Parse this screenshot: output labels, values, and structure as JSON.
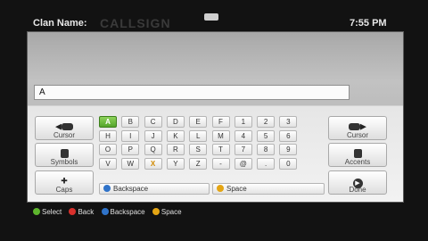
{
  "header": {
    "clan_label": "Clan Name:",
    "clan_ghost": "CALLSIGN",
    "time": "7:55 PM"
  },
  "input": {
    "value": "A"
  },
  "left_buttons": [
    {
      "label": "Cursor",
      "icon": "lb-cursor-left-icon"
    },
    {
      "label": "Symbols",
      "icon": "lt-symbols-icon"
    },
    {
      "label": "Caps",
      "icon": "stick-caps-icon"
    }
  ],
  "right_buttons": [
    {
      "label": "Cursor",
      "icon": "rb-cursor-right-icon"
    },
    {
      "label": "Accents",
      "icon": "rt-accents-icon"
    },
    {
      "label": "Done",
      "icon": "start-done-icon"
    }
  ],
  "keyboard": {
    "rows": [
      [
        "A",
        "B",
        "C",
        "D",
        "E",
        "F",
        "1",
        "2",
        "3"
      ],
      [
        "H",
        "I",
        "J",
        "K",
        "L",
        "M",
        "4",
        "5",
        "6"
      ],
      [
        "O",
        "P",
        "Q",
        "R",
        "S",
        "T",
        "7",
        "8",
        "9"
      ],
      [
        "V",
        "W",
        "X",
        "Y",
        "Z",
        "-",
        "@",
        ".",
        "0"
      ]
    ],
    "selected_key": "A",
    "backspace_label": "Backspace",
    "space_label": "Space"
  },
  "footer": {
    "select": "Select",
    "back": "Back",
    "backspace": "Backspace",
    "space": "Space"
  },
  "colors": {
    "a_button": "#5db52d",
    "b_button": "#d8302c",
    "x_button": "#2f73c9",
    "y_button": "#e4a514"
  }
}
